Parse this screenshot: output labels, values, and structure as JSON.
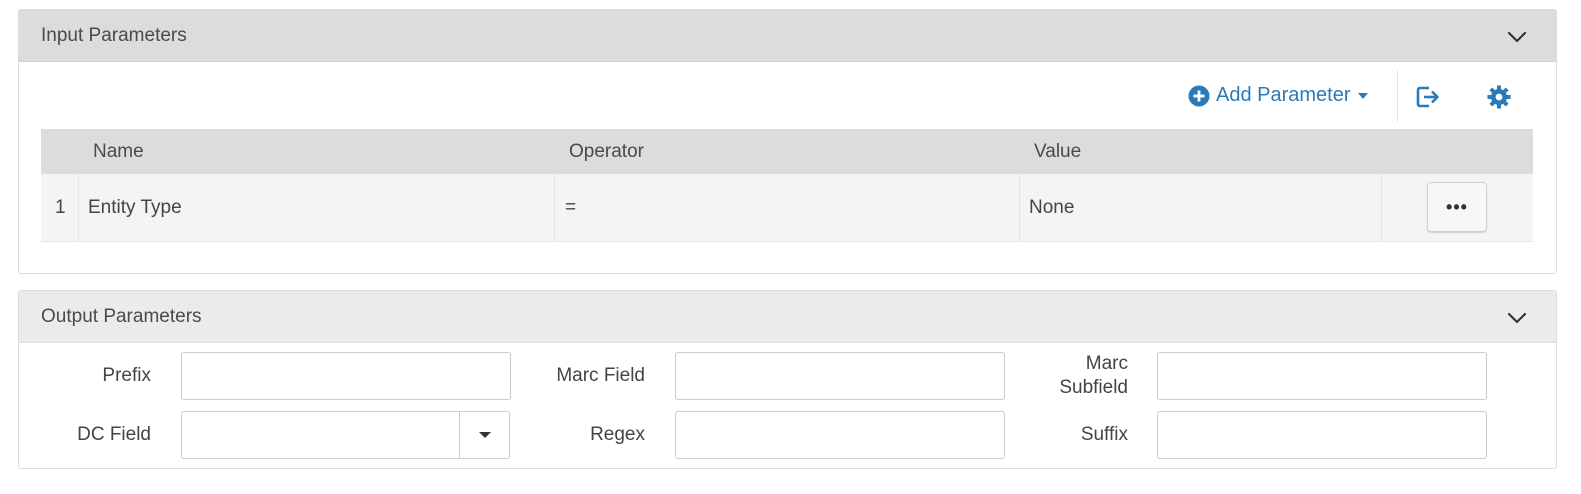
{
  "input_panel": {
    "title": "Input Parameters",
    "add_parameter_label": "Add Parameter",
    "columns": [
      "Name",
      "Operator",
      "Value"
    ],
    "rows": [
      {
        "index": "1",
        "name": "Entity Type",
        "operator": "=",
        "value": "None",
        "actions_label": "•••"
      }
    ]
  },
  "output_panel": {
    "title": "Output Parameters",
    "fields": {
      "prefix_label": "Prefix",
      "marc_field_label": "Marc Field",
      "marc_subfield_label_line1": "Marc",
      "marc_subfield_label_line2": "Subfield",
      "dc_field_label": "DC Field",
      "regex_label": "Regex",
      "suffix_label": "Suffix",
      "prefix_value": "",
      "marc_field_value": "",
      "marc_subfield_value": "",
      "dc_field_value": "",
      "regex_value": "",
      "suffix_value": ""
    }
  },
  "colors": {
    "accent": "#2a7ab7",
    "header_bg": "#dcdcdc",
    "row_bg": "#f3f4f3"
  },
  "icons": {
    "collapse": "chevron-down-icon",
    "add": "plus-circle-icon",
    "export": "export-icon",
    "settings": "gear-icon",
    "dropdown": "caret-down-icon"
  }
}
